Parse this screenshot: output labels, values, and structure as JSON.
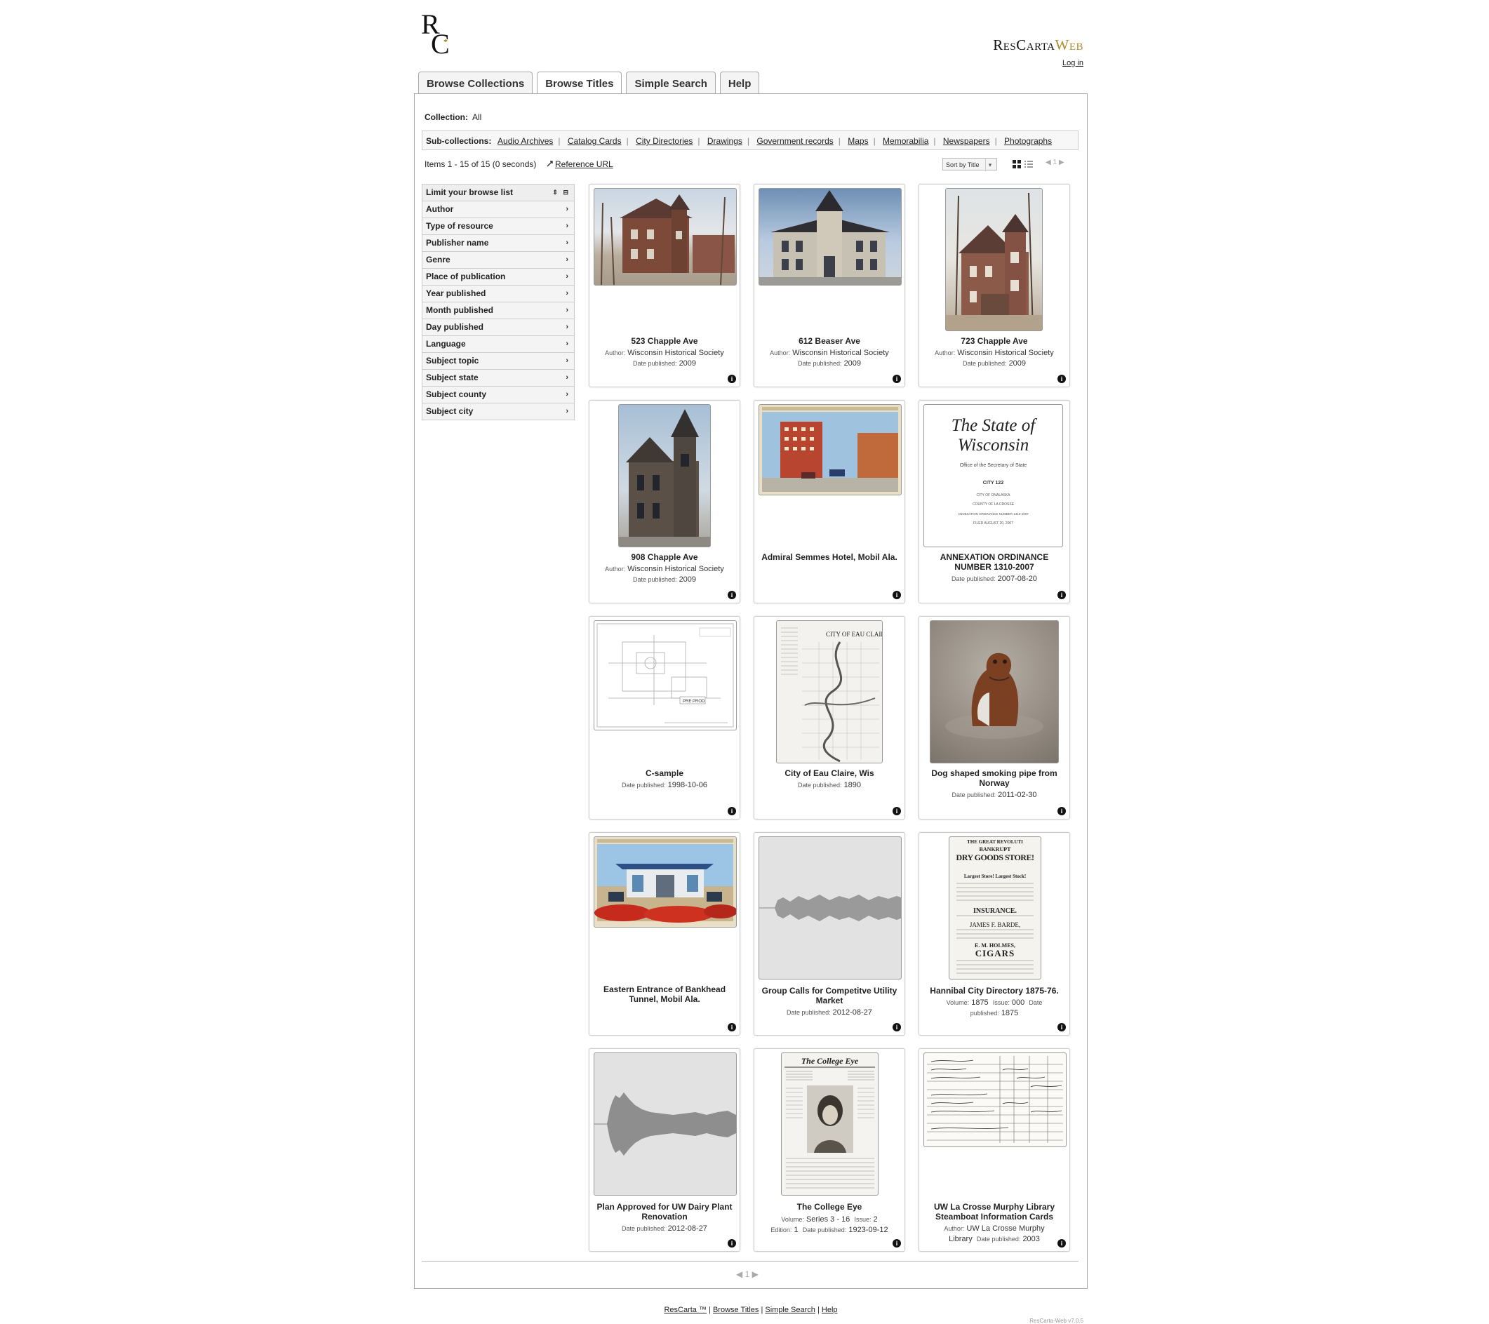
{
  "brand": {
    "logo_text": "RC",
    "name_part1": "ResCarta",
    "name_part2": "Web"
  },
  "header": {
    "login": "Log in"
  },
  "tabs": [
    {
      "label": "Browse Collections",
      "active": false
    },
    {
      "label": "Browse Titles",
      "active": true
    },
    {
      "label": "Simple Search",
      "active": false
    },
    {
      "label": "Help",
      "active": false
    }
  ],
  "collection": {
    "label": "Collection:",
    "value": "All"
  },
  "subcollections": {
    "label": "Sub-collections:",
    "items": [
      "Audio Archives",
      "Catalog Cards",
      "City Directories",
      "Drawings",
      "Government records",
      "Maps",
      "Memorabilia",
      "Newspapers",
      "Photographs"
    ]
  },
  "results": {
    "info": "Items 1 - 15 of 15 (0 seconds)",
    "reference_url": "Reference URL",
    "sort_label": "Sort by Title",
    "page": "1"
  },
  "facets": {
    "header": "Limit your browse list",
    "items": [
      "Author",
      "Type of resource",
      "Publisher name",
      "Genre",
      "Place of publication",
      "Year published",
      "Month published",
      "Day published",
      "Language",
      "Subject topic",
      "Subject state",
      "Subject county",
      "Subject city"
    ]
  },
  "labels": {
    "author": "Author:",
    "date": "Date published:",
    "volume": "Volume:",
    "issue": "Issue:",
    "edition": "Edition:"
  },
  "items": [
    {
      "title": "523 Chapple Ave",
      "author": "Wisconsin Historical Society",
      "date": "2009",
      "thumb": "photo-house-brick"
    },
    {
      "title": "612 Beaser Ave",
      "author": "Wisconsin Historical Society",
      "date": "2009",
      "thumb": "photo-school"
    },
    {
      "title": "723 Chapple Ave",
      "author": "Wisconsin Historical Society",
      "date": "2009",
      "thumb": "photo-house-tall"
    },
    {
      "title": "908 Chapple Ave",
      "author": "Wisconsin Historical Society",
      "date": "2009",
      "thumb": "photo-church"
    },
    {
      "title": "Admiral Semmes Hotel, Mobil Ala.",
      "thumb": "postcard-hotel"
    },
    {
      "title": "ANNEXATION ORDINANCE NUMBER 1310-2007",
      "date": "2007-08-20",
      "thumb": "document-state",
      "doc_heading": "The State of Wisconsin",
      "doc_lines": [
        "Office of the Secretary of State",
        "CITY 122",
        "CITY OF ONALASKA",
        "COUNTY OF LA CROSSE",
        "ANNEXATION ORDINANCE NUMBER 1310-2007",
        "FILED AUGUST 20, 2007"
      ]
    },
    {
      "title": "C-sample",
      "date": "1998-10-06",
      "thumb": "drawing"
    },
    {
      "title": "City of Eau Claire, Wis",
      "date": "1890",
      "thumb": "map",
      "map_title": "CITY OF EAU CLAIRE"
    },
    {
      "title": "Dog shaped smoking pipe from Norway",
      "date": "2011-02-30",
      "thumb": "photo-dog-pipe"
    },
    {
      "title": "Eastern Entrance of Bankhead Tunnel, Mobil Ala.",
      "thumb": "postcard-tunnel"
    },
    {
      "title": "Group Calls for Competitve Utility Market",
      "date": "2012-08-27",
      "thumb": "audio-waveform"
    },
    {
      "title": "Hannibal City Directory 1875-76.",
      "volume": "1875",
      "issue": "000",
      "date": "1875",
      "thumb": "directory-page",
      "page_lines": [
        "THE GREAT REVOLUTI",
        "BANKRUPT",
        "DRY GOODS STORE!",
        "Largest Store! Largest Stock!",
        "INSURANCE.",
        "JAMES F. BARDE,",
        "E. M. HOLMES,",
        "CIGARS"
      ]
    },
    {
      "title": "Plan Approved for UW Dairy Plant Renovation",
      "date": "2012-08-27",
      "thumb": "audio-waveform"
    },
    {
      "title": "The College Eye",
      "volume": "Series 3 - 16",
      "issue": "2",
      "edition": "1",
      "date": "1923-09-12",
      "thumb": "newspaper",
      "masthead": "The College Eye"
    },
    {
      "title": "UW La Crosse Murphy Library Steamboat Information Cards",
      "author": "UW La Crosse Murphy Library",
      "date": "2003",
      "thumb": "catalog-card"
    }
  ],
  "footer": {
    "links": [
      "ResCarta ™",
      "Browse Titles",
      "Simple Search",
      "Help"
    ],
    "version": "ResCarta-Web v7.0.5"
  },
  "colors": {
    "brand_gold": "#b08d2c",
    "panel_border": "#aaaaaa"
  }
}
